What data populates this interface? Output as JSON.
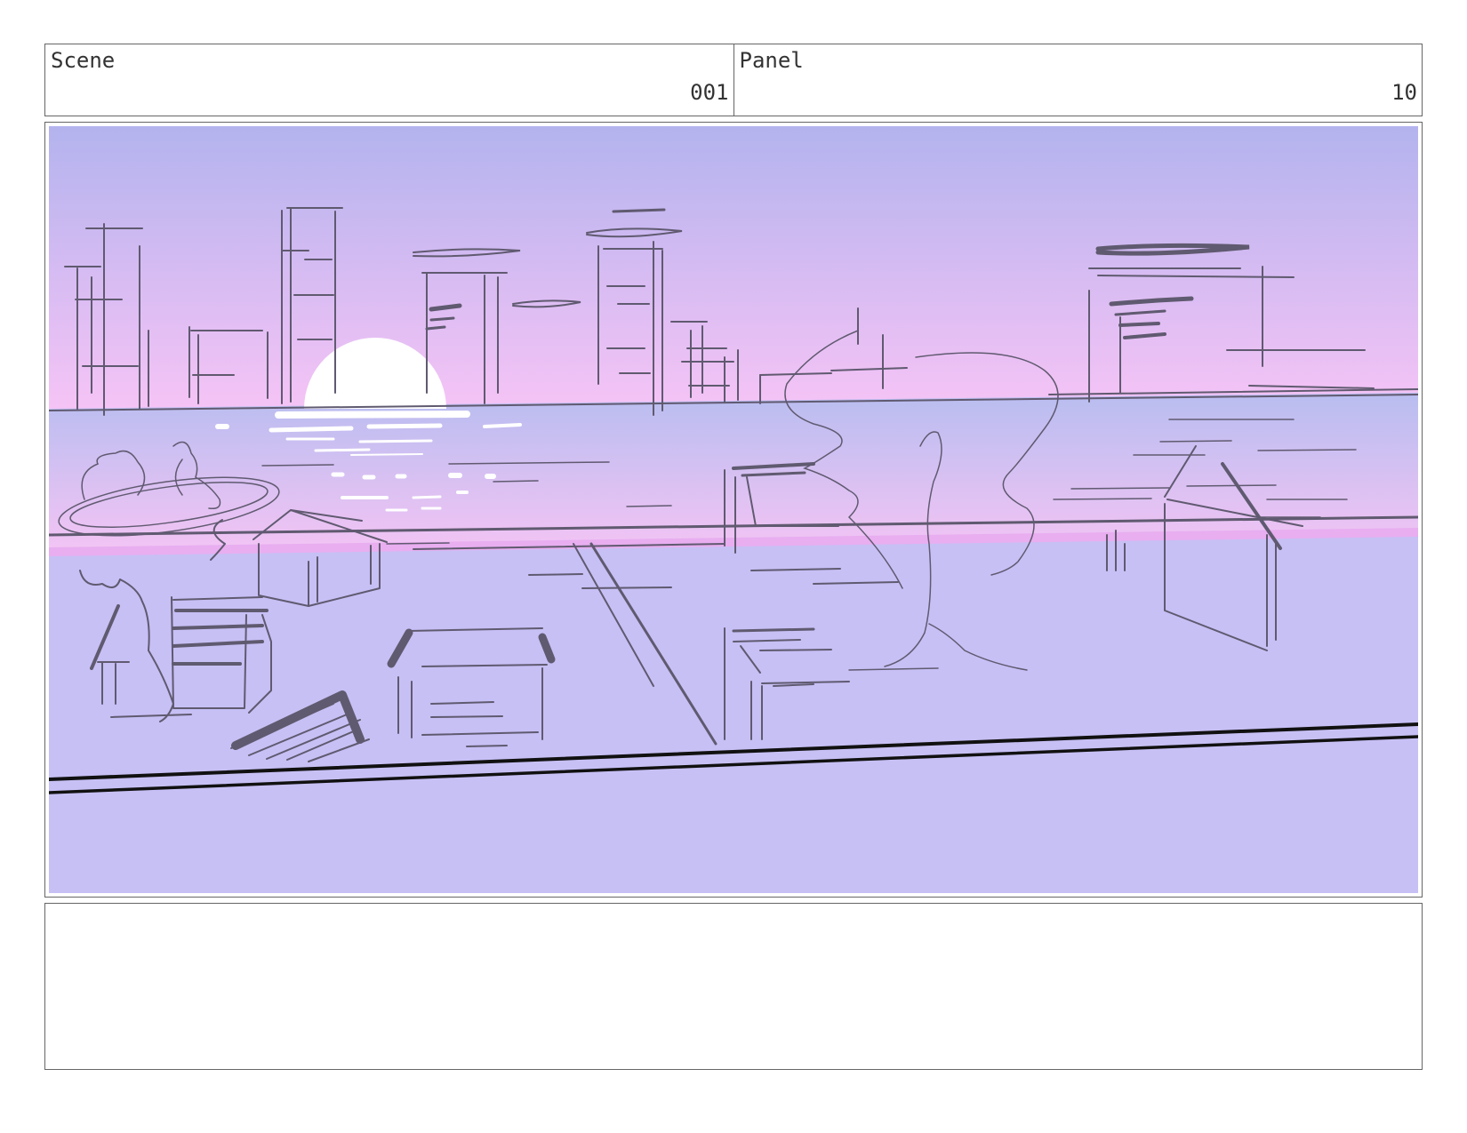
{
  "header": {
    "scene_label": "Scene",
    "scene_number": "001",
    "panel_label": "Panel",
    "panel_number": "10"
  },
  "drawing": {
    "sky_top_color": "#b3b3ee",
    "sky_horizon_color": "#f8c4f6",
    "water_color": "#b8bdf0",
    "ground_color": "#c7c0f5",
    "sun_color": "#ffffff",
    "sketch_color": "#605a70"
  },
  "notes": {
    "text": ""
  }
}
